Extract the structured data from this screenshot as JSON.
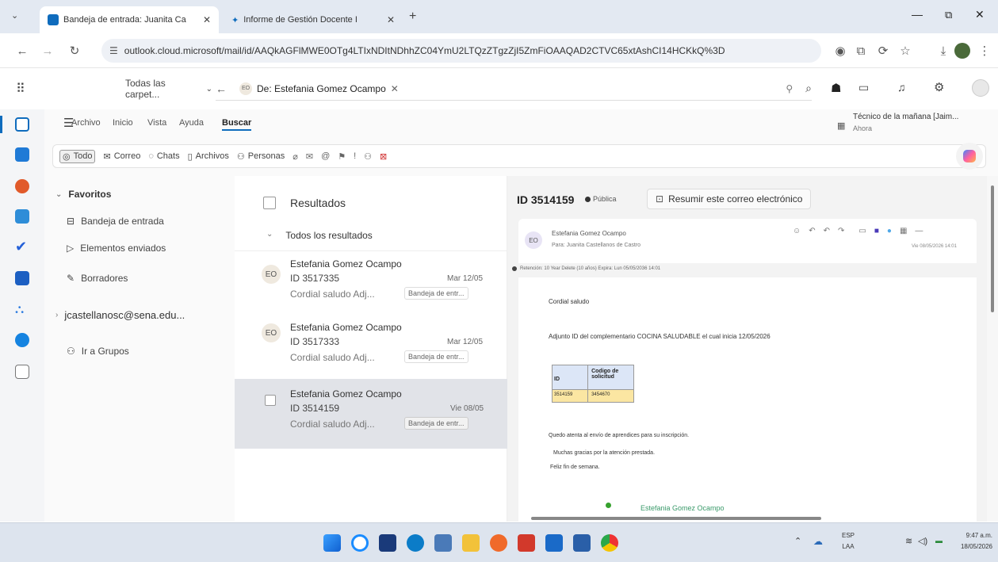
{
  "browser": {
    "tabs": [
      {
        "title": "Bandeja de entrada: Juanita Ca"
      },
      {
        "title": "Informe de Gestión Docente I"
      }
    ],
    "url": "outlook.cloud.microsoft/mail/id/AAQkAGFlMWE0OTg4LTIxNDItNDhhZC04YmU2LTQzZTgzZjI5ZmFiOAAQAD2CTVC65xtAshCI14HCKkQ%3D"
  },
  "header": {
    "folder_select": "Todas las carpet...",
    "search_chip": "De: Estefania Gomez Ocampo",
    "chip_avatar": "EO"
  },
  "ribbon": {
    "menu": [
      "Archivo",
      "Inicio",
      "Vista",
      "Ayuda",
      "Buscar"
    ],
    "reminder_title": "Técnico de la mañana [Jaim...",
    "reminder_sub": "Ahora",
    "filters": [
      "Todo",
      "Correo",
      "Chats",
      "Archivos",
      "Personas"
    ]
  },
  "nav": {
    "favoritos": "Favoritos",
    "items": [
      "Bandeja de entrada",
      "Elementos enviados",
      "Borradores"
    ],
    "account": "jcastellanosc@sena.edu...",
    "groups": "Ir a Grupos"
  },
  "list": {
    "header": "Resultados",
    "group": "Todos los resultados",
    "messages": [
      {
        "avatar": "EO",
        "sender": "Estefania Gomez Ocampo",
        "subject": "ID 3517335",
        "date": "Mar 12/05",
        "preview": "Cordial saludo Adj...",
        "folder": "Bandeja de entr..."
      },
      {
        "avatar": "EO",
        "sender": "Estefania Gomez Ocampo",
        "subject": "ID 3517333",
        "date": "Mar 12/05",
        "preview": "Cordial saludo Adj...",
        "folder": "Bandeja de entr..."
      },
      {
        "avatar": "EO",
        "sender": "Estefania Gomez Ocampo",
        "subject": "ID 3514159",
        "date": "Vie 08/05",
        "preview": "Cordial saludo Adj...",
        "folder": "Bandeja de entr..."
      }
    ]
  },
  "reading": {
    "subject": "ID 3514159",
    "badge": "Pública",
    "summarize": "Resumir este correo electrónico",
    "from": "Estefania Gomez Ocampo",
    "to": "Para: Juanita Castellanos de Castro",
    "datetime": "Vie 08/05/2026 14:01",
    "retention": "Retención: 10 Year Delete (10 años) Expira: Lun 05/05/2036 14:01",
    "greeting": "Cordial saludo",
    "line1": "Adjunto ID del complementario COCINA SALUDABLE el cual inicia 12/05/2026",
    "table_headers": [
      "ID",
      "Codigo de solicitud"
    ],
    "table_row": [
      "3514159",
      "3454670"
    ],
    "line2": "Quedo atenta al envío de aprendices para su inscripción.",
    "line3": "Muchas gracias por la atención prestada.",
    "line4": "Feliz fin de semana.",
    "signature": "Estefania Gomez Ocampo"
  },
  "taskbar": {
    "lang": "ESP",
    "lang2": "LAA",
    "time": "9:47 a.m.",
    "date": "18/05/2026"
  },
  "colors": {
    "accent": "#0f6cbd",
    "selected_row": "#e1e3e8",
    "table_header": "#dce6f7",
    "table_row": "#fbe6a2"
  }
}
